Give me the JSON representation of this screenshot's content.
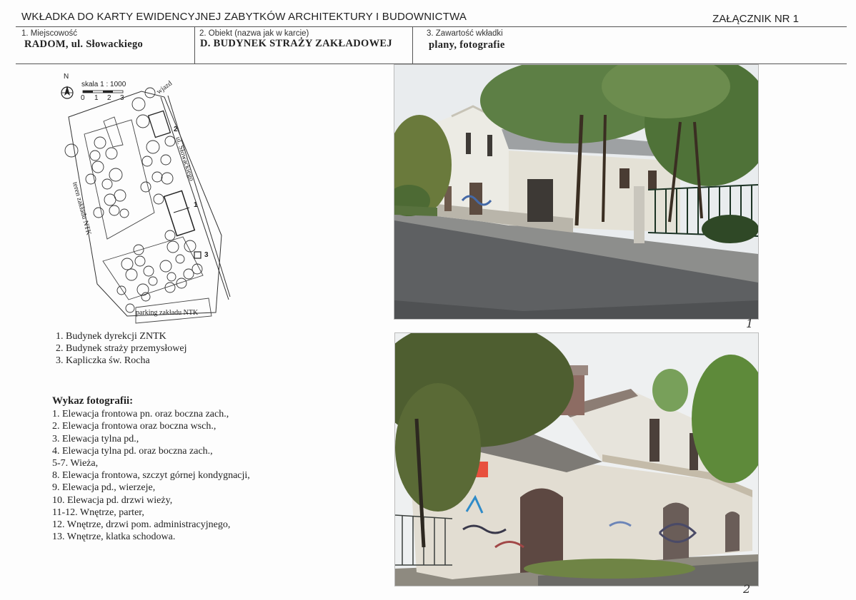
{
  "header": {
    "title": "WKŁADKA DO KARTY EWIDENCYJNEJ ZABYTKÓW ARCHITEKTURY I BUDOWNICTWA",
    "annex": "ZAŁĄCZNIK NR 1"
  },
  "fields": {
    "locality_label": "1. Miejscowość",
    "locality_value": "RADOM, ul. Słowackiego",
    "object_label": "2. Obiekt (nazwa jak w karcie)",
    "object_value": "D. BUDYNEK STRAŻY ZAKŁADOWEJ",
    "contents_label": "3. Zawartość wkładki",
    "contents_value": "plany, fotografie"
  },
  "map": {
    "scale_label": "skala 1 : 1000",
    "scale_ticks": [
      "0",
      "1",
      "2",
      "3"
    ],
    "north": "N",
    "street": "ul. Słowackiego",
    "entrance": "wjazd",
    "plant_area": "teren zakładu NTK",
    "parking": "parking zakładu NTK",
    "markers": [
      "1",
      "2",
      "3"
    ]
  },
  "legend": [
    "1. Budynek dyrekcji ZNTK",
    "2. Budynek straży przemysłowej",
    "3. Kapliczka św. Rocha"
  ],
  "photo_list": {
    "heading": "Wykaz fotografii:",
    "items": [
      "1. Elewacja frontowa pn. oraz boczna zach.,",
      "2. Elewacja frontowa oraz boczna wsch.,",
      "3. Elewacja tylna pd.,",
      "4. Elewacja tylna pd. oraz boczna zach.,",
      "5-7. Wieża,",
      "8. Elewacja frontowa, szczyt górnej kondygnacji,",
      "9. Elewacja pd., wierzeje,",
      "10. Elewacja pd. drzwi wieży,",
      "11-12. Wnętrze, parter,",
      "12. Wnętrze, drzwi pom. administracyjnego,",
      "13. Wnętrze, klatka schodowa."
    ]
  },
  "photos": {
    "photo1_number": "1",
    "photo2_number": "2"
  }
}
